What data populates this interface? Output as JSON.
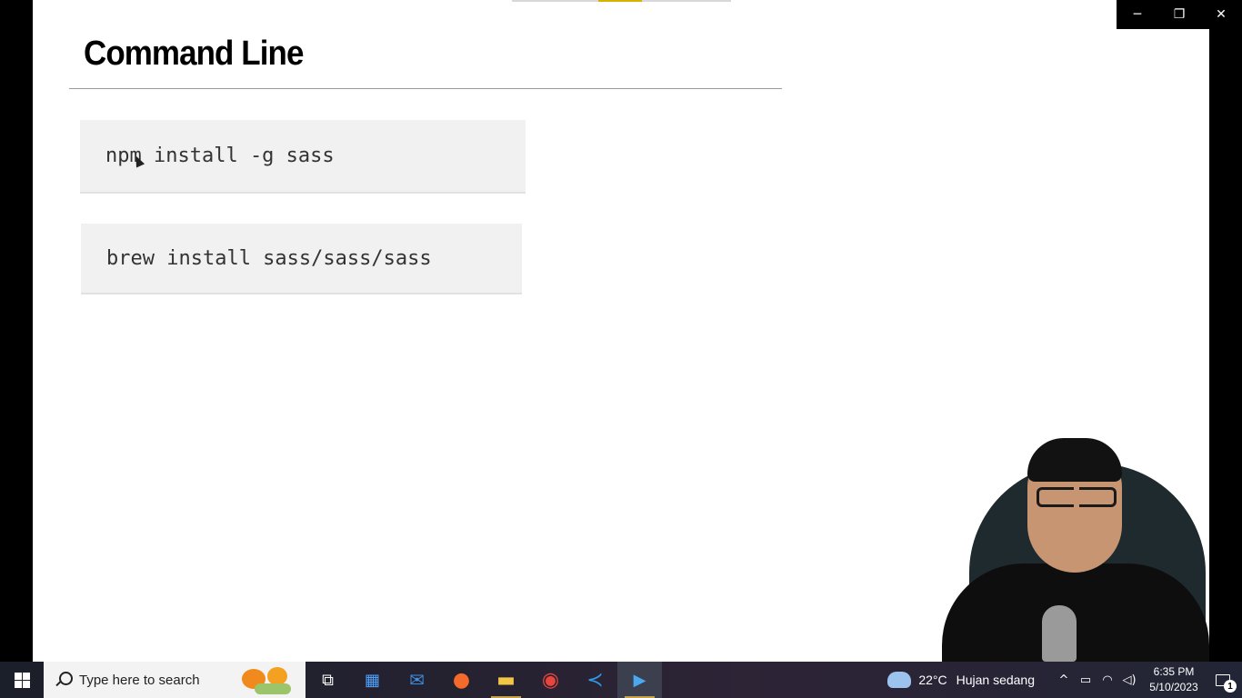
{
  "slide": {
    "title": "Command Line",
    "commands": [
      "npm install -g sass",
      "brew install sass/sass/sass"
    ]
  },
  "window_controls": {
    "minimize": "─",
    "restore": "❐",
    "close": "✕"
  },
  "taskbar": {
    "search_placeholder": "Type here to search",
    "apps": [
      {
        "name": "task-view-icon",
        "glyph": "⧉"
      },
      {
        "name": "microsoft-store-icon",
        "glyph": "▦"
      },
      {
        "name": "mail-icon",
        "glyph": "✉"
      },
      {
        "name": "firefox-icon",
        "glyph": "●"
      },
      {
        "name": "file-explorer-icon",
        "glyph": "▬"
      },
      {
        "name": "chrome-icon",
        "glyph": "◉"
      },
      {
        "name": "vscode-icon",
        "glyph": "≺"
      },
      {
        "name": "media-player-icon",
        "glyph": "▶"
      }
    ],
    "weather": {
      "temperature": "22°C",
      "condition": "Hujan sedang"
    },
    "clock": {
      "time": "6:35 PM",
      "date": "5/10/2023"
    },
    "notification_count": "1",
    "colors": {
      "active_indicator": "#c6a04a",
      "search_bg": "#f3f3f3"
    }
  }
}
